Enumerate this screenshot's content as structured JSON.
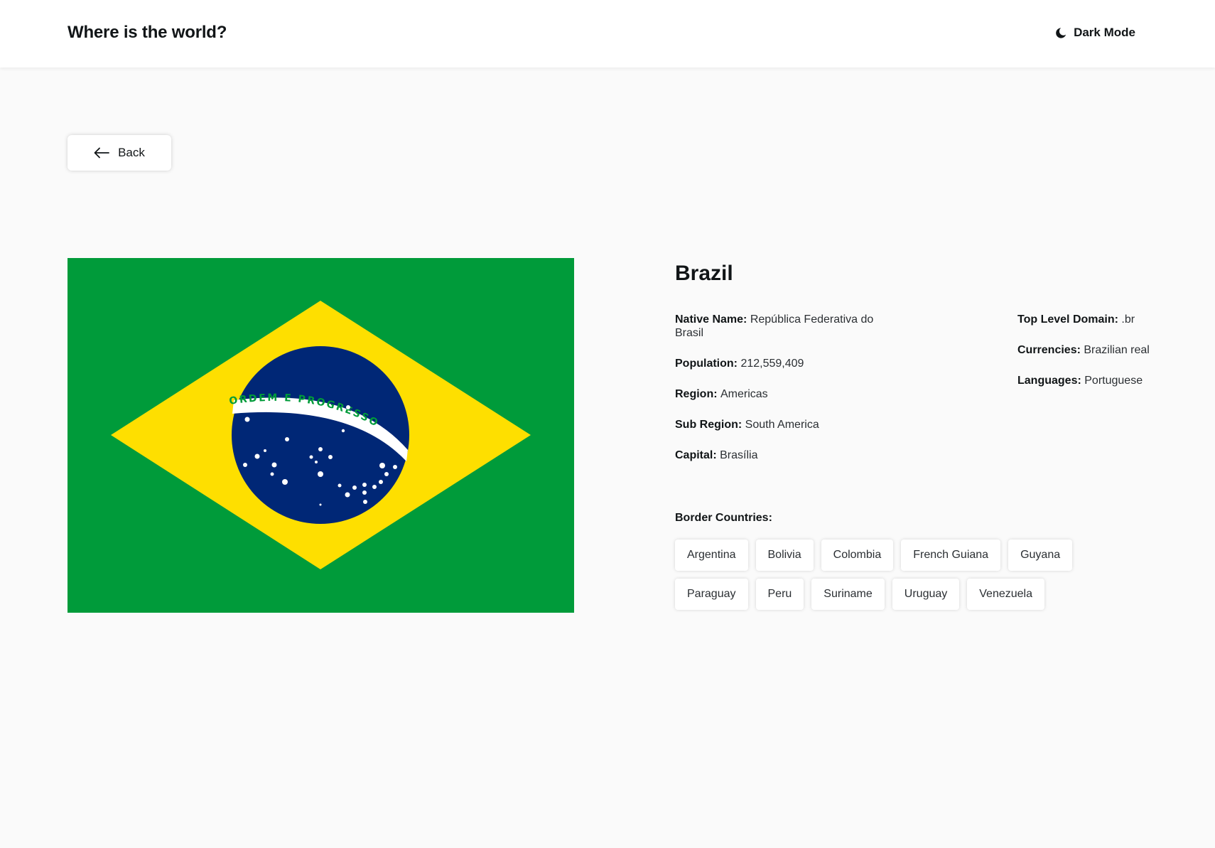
{
  "header": {
    "title": "Where is the world?",
    "dark_mode_label": "Dark Mode",
    "dark_mode_icon": "moon-icon"
  },
  "back_button": {
    "label": "Back",
    "icon": "arrow-left-icon"
  },
  "flag": {
    "motto": "ORDEM E PROGRESSO",
    "colors": {
      "green": "#009b3a",
      "yellow": "#fedf00",
      "blue": "#002776",
      "white": "#ffffff"
    }
  },
  "country": {
    "name": "Brazil",
    "left_fields": [
      {
        "key": "Native Name:",
        "value": "República Federativa do Brasil"
      },
      {
        "key": "Population:",
        "value": "212,559,409"
      },
      {
        "key": "Region:",
        "value": "Americas"
      },
      {
        "key": "Sub Region:",
        "value": "South America"
      },
      {
        "key": "Capital:",
        "value": "Brasília"
      }
    ],
    "right_fields": [
      {
        "key": "Top Level Domain:",
        "value": ".br"
      },
      {
        "key": "Currencies:",
        "value": "Brazilian real"
      },
      {
        "key": "Languages:",
        "value": "Portuguese"
      }
    ],
    "border_title": "Border Countries:",
    "borders": [
      "Argentina",
      "Bolivia",
      "Colombia",
      "French Guiana",
      "Guyana",
      "Paraguay",
      "Peru",
      "Suriname",
      "Uruguay",
      "Venezuela"
    ]
  },
  "colors": {
    "page_background": "#fafafa",
    "element_background": "#ffffff",
    "text": "#111517"
  }
}
